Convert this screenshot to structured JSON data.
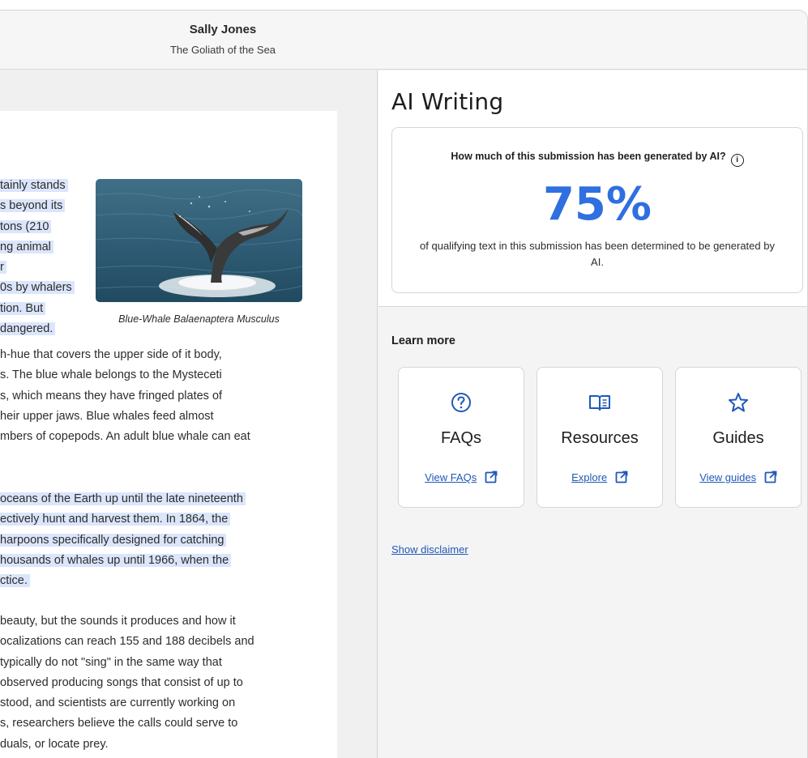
{
  "header": {
    "author": "Sally Jones",
    "document_title": "The Goliath of the Sea"
  },
  "document": {
    "block1_lines": [
      "tainly stands",
      "s beyond its",
      "tons (210",
      "ng animal",
      "r",
      "0s by whalers",
      "tion. But",
      "dangered."
    ],
    "block2_lines": [
      "h-hue that covers the upper side of it body,",
      "s. The blue whale belongs to the Mysteceti",
      "s, which means they have fringed plates of",
      "heir upper jaws. Blue whales feed almost",
      "mbers of copepods. An adult blue whale can eat"
    ],
    "block3_lines": [
      "oceans of the Earth up until the late nineteenth",
      "ectively hunt and harvest them. In 1864, the",
      " harpoons specifically designed for catching",
      "housands of whales up until 1966, when the",
      "ctice."
    ],
    "block4_lines": [
      "beauty, but the sounds it produces and how it",
      "ocalizations can reach 155 and 188 decibels and",
      " typically do not \"sing\" in the same way that",
      "observed producing songs that consist of up to",
      "stood, and scientists are currently working on",
      "s, researchers believe the calls could serve to",
      "duals, or locate prey."
    ],
    "image_caption": "Blue-Whale Balaenaptera Musculus"
  },
  "ai_panel": {
    "title": "AI Writing",
    "question": "How much of this submission has been generated by AI?",
    "percentage": "75%",
    "description": "of qualifying text in this submission has been determined to be generated by AI.",
    "learn_more_label": "Learn more",
    "cards": [
      {
        "icon": "question-circle-icon",
        "title": "FAQs",
        "link": "View FAQs"
      },
      {
        "icon": "book-icon",
        "title": "Resources",
        "link": "Explore"
      },
      {
        "icon": "star-icon",
        "title": "Guides",
        "link": "View guides"
      }
    ],
    "disclaimer_link": "Show disclaimer"
  },
  "colors": {
    "accent": "#2f6fe0",
    "link": "#2058b8",
    "highlight": "#dbe5fb"
  }
}
